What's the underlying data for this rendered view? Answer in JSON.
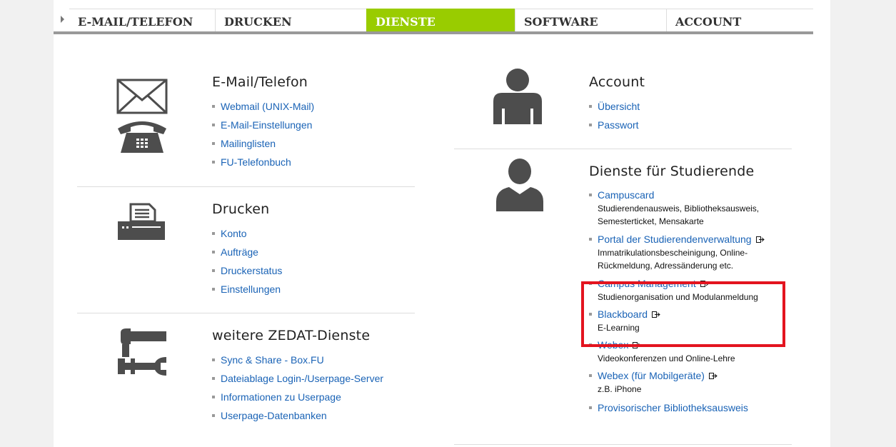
{
  "nav": {
    "tabs": [
      {
        "label": "E-MAIL/TELEFON",
        "active": false
      },
      {
        "label": "DRUCKEN",
        "active": false
      },
      {
        "label": "DIENSTE",
        "active": true
      },
      {
        "label": "SOFTWARE",
        "active": false
      },
      {
        "label": "ACCOUNT",
        "active": false
      }
    ],
    "active_color": "#99cc00"
  },
  "email": {
    "title": "E-Mail/Telefon",
    "links": [
      "Webmail (UNIX-Mail)",
      "E-Mail-Einstellungen",
      "Mailinglisten",
      "FU-Telefonbuch"
    ]
  },
  "drucken": {
    "title": "Drucken",
    "links": [
      "Konto",
      "Aufträge",
      "Druckerstatus",
      "Einstellungen"
    ]
  },
  "weitere": {
    "title": "weitere ZEDAT-Dienste",
    "links": [
      "Sync & Share - Box.FU",
      "Dateiablage Login-/Userpage-Server",
      "Informationen zu Userpage",
      "Userpage-Datenbanken"
    ]
  },
  "account": {
    "title": "Account",
    "links": [
      "Übersicht",
      "Passwort"
    ]
  },
  "studierende": {
    "title": "Dienste für Studierende",
    "items": [
      {
        "label": "Campuscard",
        "desc_lines": [
          "Studierendenausweis, Bibliotheksausweis,",
          "Semesterticket, Mensakarte"
        ],
        "external": false
      },
      {
        "label": "Portal der Studierendenverwaltung",
        "desc_lines": [
          "Immatrikulationsbescheinigung, Online-",
          "Rückmeldung, Adressänderung etc."
        ],
        "external": true
      },
      {
        "label": "Campus Management",
        "desc_lines": [
          "Studienorganisation und Modulanmeldung"
        ],
        "external": true
      },
      {
        "label": "Blackboard",
        "desc_lines": [
          "E-Learning"
        ],
        "external": true
      },
      {
        "label": "Webex",
        "desc_lines": [
          "Videokonferenzen und Online-Lehre"
        ],
        "external": true
      },
      {
        "label": "Webex (für Mobilgeräte)",
        "desc_lines": [
          "z.B. iPhone"
        ],
        "external": true
      },
      {
        "label": "Provisorischer Bibliotheksausweis",
        "desc_lines": [],
        "external": false
      }
    ]
  },
  "icons": {
    "email": "envelope-icon",
    "phone": "telephone-icon",
    "printer": "printer-icon",
    "tools": "hammer-wrench-icon",
    "account": "person-icon",
    "student": "student-icon",
    "external": "external-link-icon"
  },
  "colors": {
    "link": "#1a63b6",
    "highlight": "#e3141f",
    "icon": "#4d4d4d"
  }
}
